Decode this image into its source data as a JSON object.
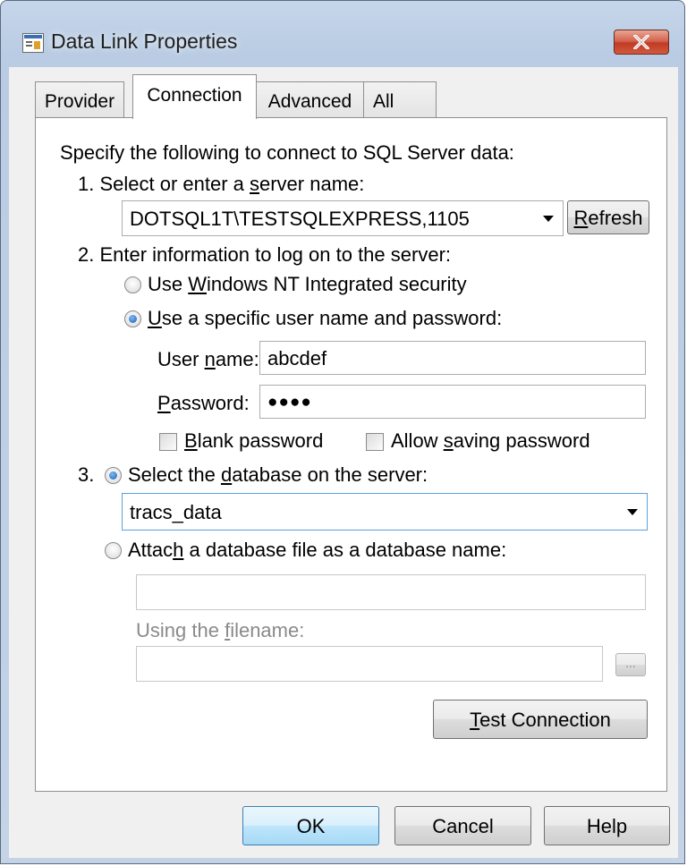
{
  "window": {
    "title": "Data Link Properties"
  },
  "tabs": [
    {
      "label": "Provider"
    },
    {
      "label": "Connection"
    },
    {
      "label": "Advanced"
    },
    {
      "label": "All"
    }
  ],
  "connection": {
    "intro": "Specify the following to connect to SQL Server data:",
    "step1": {
      "label_pre": "1. Select or enter a ",
      "label_u": "s",
      "label_post": "erver name:",
      "server_value": "DOTSQL1T\\TESTSQLEXPRESS,1105",
      "refresh_u": "R",
      "refresh_rest": "efresh"
    },
    "step2": {
      "label": "2. Enter information to log on to the server:",
      "radio_windows": {
        "pre": "Use ",
        "u": "W",
        "post": "indows NT Integrated security",
        "checked": false
      },
      "radio_specific": {
        "pre": "",
        "u": "U",
        "post": "se a specific user name and password:",
        "checked": true
      },
      "username_label": {
        "pre": "User ",
        "u": "n",
        "post": "ame:"
      },
      "username_value": "abcdef",
      "password_label": {
        "pre": "",
        "u": "P",
        "post": "assword:"
      },
      "password_value": "●●●●",
      "blank_password": {
        "pre": "",
        "u": "B",
        "post": "lank password",
        "checked": false
      },
      "allow_saving": {
        "pre": "Allow ",
        "u": "s",
        "post": "aving password",
        "checked": false
      }
    },
    "step3": {
      "number": "3.",
      "radio_select": {
        "pre": "Select the ",
        "u": "d",
        "post": "atabase on the server:",
        "checked": true
      },
      "database_value": "tracs_data",
      "radio_attach": {
        "pre": "Attac",
        "u": "h",
        "post": " a database file as a database name:",
        "checked": false
      },
      "attach_name_value": "",
      "filename_label": {
        "pre": "Using the ",
        "u": "f",
        "post": "ilename:"
      },
      "filename_value": "",
      "browse_label": "..."
    },
    "test_connection": {
      "u": "T",
      "post": "est Connection"
    }
  },
  "footer": {
    "ok": "OK",
    "cancel": "Cancel",
    "help": "Help"
  }
}
